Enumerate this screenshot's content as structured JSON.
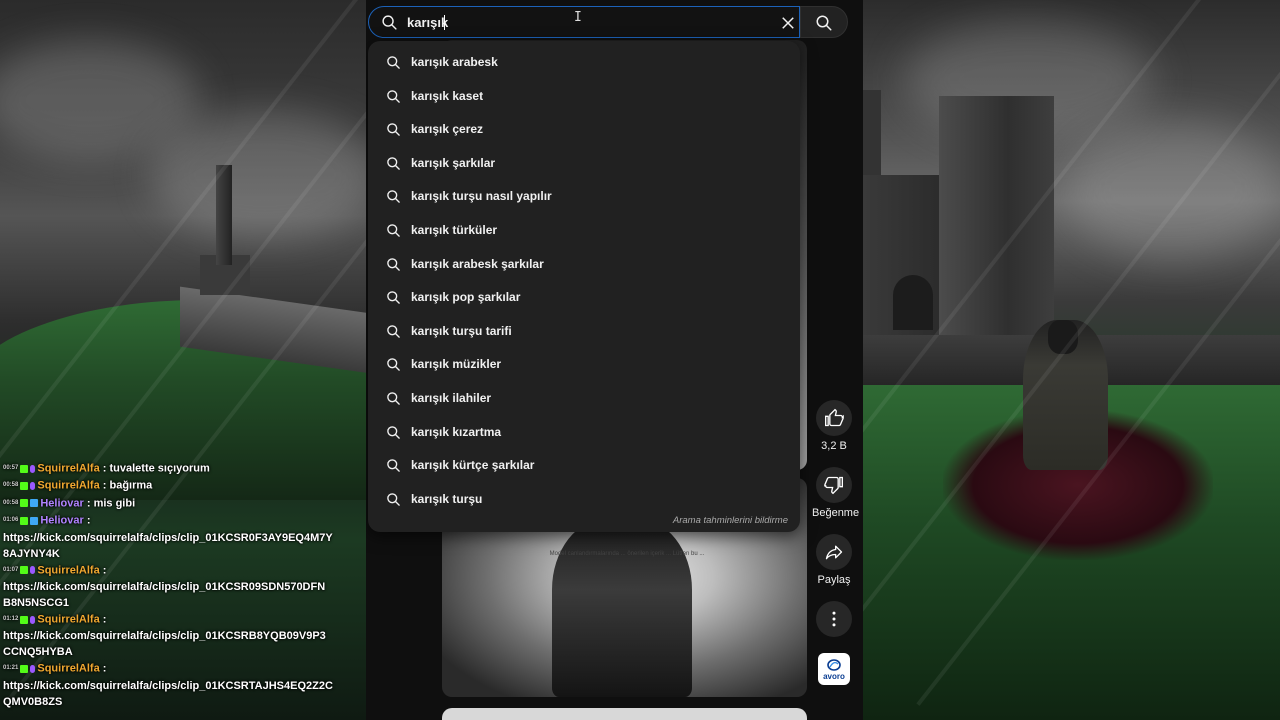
{
  "search": {
    "query": "karışık",
    "clear_icon": "close-icon",
    "submit_icon": "search-icon"
  },
  "suggestions": [
    "karışık arabesk",
    "karışık kaset",
    "karışık çerez",
    "karışık şarkılar",
    "karışık turşu nasıl yapılır",
    "karışık türküler",
    "karışık arabesk şarkılar",
    "karışık pop şarkılar",
    "karışık turşu tarifi",
    "karışık müzikler",
    "karışık ilahiler",
    "karışık kızartma",
    "karışık kürtçe şarkılar",
    "karışık turşu"
  ],
  "report_predictions": "Arama tahminlerini bildirme",
  "actions": {
    "like_count": "3,2 B",
    "dislike_label": "Beğenme",
    "share_label": "Paylaş",
    "channel_avatar_text": "avoro"
  },
  "video_notice": "Model canlandırmalarında ... önerilen içerik ... Lütfen bu ...",
  "chat": [
    {
      "time": "00:57",
      "user": "SquirrelAlfa",
      "color": "orange",
      "msg": "tuvalette sıçıyorum",
      "badges": [
        "kick",
        "mic"
      ]
    },
    {
      "time": "00:58",
      "user": "SquirrelAlfa",
      "color": "orange",
      "msg": "bağırma",
      "badges": [
        "kick",
        "mic"
      ]
    },
    {
      "time": "00:58",
      "user": "Heliovar",
      "color": "purple",
      "msg": "mis gibi",
      "badges": [
        "kick",
        "sub"
      ]
    },
    {
      "time": "01:06",
      "user": "Heliovar",
      "color": "purple",
      "msg": "https://kick.com/squirrelalfa/clips/clip_01KCSR0F3AY9EQ4M7Y8AJYNY4K",
      "badges": [
        "kick",
        "sub"
      ]
    },
    {
      "time": "01:07",
      "user": "SquirrelAlfa",
      "color": "orange",
      "msg": "https://kick.com/squirrelalfa/clips/clip_01KCSR09SDN570DFNB8N5NSCG1",
      "badges": [
        "kick",
        "mic"
      ]
    },
    {
      "time": "01:12",
      "user": "SquirrelAlfa",
      "color": "orange",
      "msg": "https://kick.com/squirrelalfa/clips/clip_01KCSRB8YQB09V9P3CCNQ5HYBA",
      "badges": [
        "kick",
        "mic"
      ]
    },
    {
      "time": "01:21",
      "user": "SquirrelAlfa",
      "color": "orange",
      "msg": "https://kick.com/squirrelalfa/clips/clip_01KCSRTAJHS4EQ2Z2CQMV0B8ZS",
      "badges": [
        "kick",
        "mic"
      ]
    }
  ],
  "colors": {
    "accent_border": "#1c62b9",
    "dropdown_bg": "#212121",
    "page_bg": "#0f0f0f",
    "chat_orange": "#f0a830",
    "chat_purple": "#b083ff"
  }
}
